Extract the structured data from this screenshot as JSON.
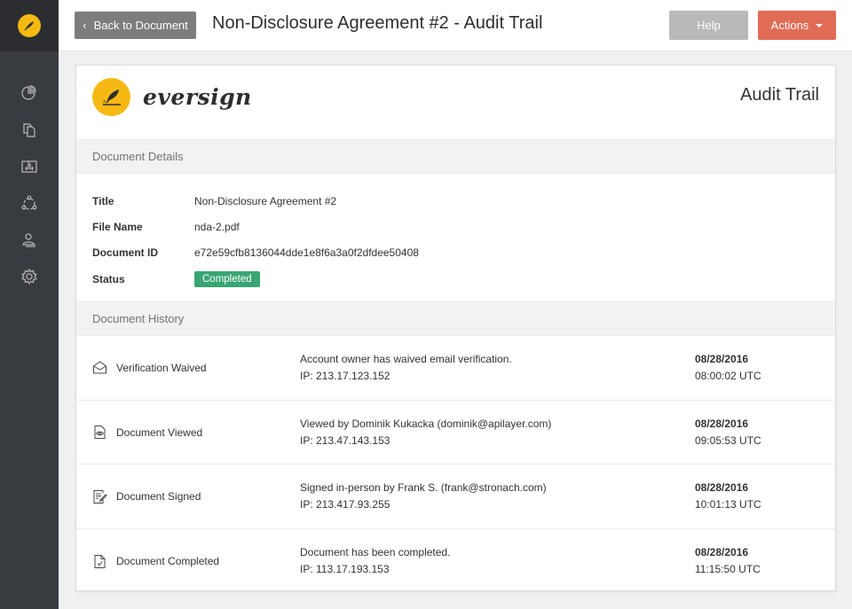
{
  "sidebar": {
    "logo_icon": "quill-icon",
    "items": [
      {
        "icon": "pie-chart-icon",
        "label": "Dashboard"
      },
      {
        "icon": "documents-icon",
        "label": "Documents"
      },
      {
        "icon": "templates-icon",
        "label": "Templates"
      },
      {
        "icon": "team-icon",
        "label": "Team"
      },
      {
        "icon": "contacts-icon",
        "label": "Contacts"
      },
      {
        "icon": "gear-icon",
        "label": "Settings"
      }
    ]
  },
  "topbar": {
    "back_label": "Back to Document",
    "title": "Non-Disclosure Agreement #2 - Audit Trail",
    "help_label": "Help",
    "actions_label": "Actions"
  },
  "card": {
    "brand_name": "eversign",
    "audit_title": "Audit Trail",
    "details_heading": "Document Details",
    "history_heading": "Document History",
    "details": {
      "title_label": "Title",
      "title_value": "Non-Disclosure Agreement #2",
      "file_label": "File Name",
      "file_value": "nda-2.pdf",
      "id_label": "Document ID",
      "id_value": "e72e59cfb8136044dde1e8f6a3a0f2dfdee50408",
      "status_label": "Status",
      "status_value": "Completed",
      "status_color": "#3aa574"
    },
    "history": [
      {
        "icon": "envelope-open-icon",
        "event": "Verification Waived",
        "description": "Account owner has waived email verification.",
        "ip": "IP: 213.17.123.152",
        "date": "08/28/2016",
        "time": "08:00:02 UTC"
      },
      {
        "icon": "document-eye-icon",
        "event": "Document Viewed",
        "description": "Viewed by Dominik Kukacka (dominik@apilayer.com)",
        "ip": "IP: 213.47.143.153",
        "date": "08/28/2016",
        "time": "09:05:53 UTC"
      },
      {
        "icon": "document-pen-icon",
        "event": "Document Signed",
        "description": "Signed in-person by Frank S. (frank@stronach.com)",
        "ip": "IP: 213.417.93.255",
        "date": "08/28/2016",
        "time": "10:01:13 UTC"
      },
      {
        "icon": "document-check-icon",
        "event": "Document Completed",
        "description": "Document has been completed.",
        "ip": "IP: 113.17.193.153",
        "date": "08/28/2016",
        "time": "11:15:50 UTC"
      }
    ]
  },
  "colors": {
    "accent_yellow": "#f6b913",
    "actions_red": "#e06c56",
    "sidebar_dark": "#383b40"
  }
}
